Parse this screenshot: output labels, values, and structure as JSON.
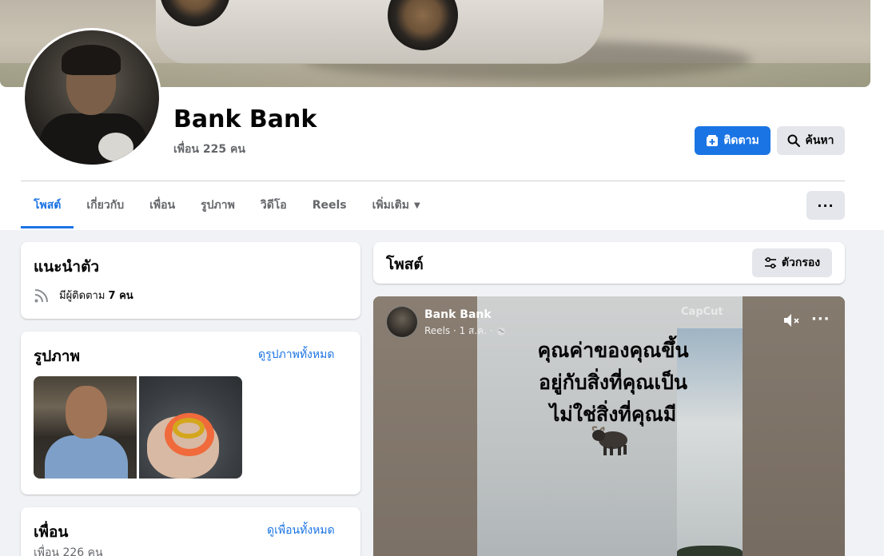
{
  "profile": {
    "name": "Bank Bank",
    "friends_count": "เพื่อน 225 คน"
  },
  "actions": {
    "follow_label": "ติดตาม",
    "search_label": "ค้นหา",
    "more_label": "···"
  },
  "tabs": [
    {
      "label": "โพสต์",
      "active": true
    },
    {
      "label": "เกี่ยวกับ"
    },
    {
      "label": "เพื่อน"
    },
    {
      "label": "รูปภาพ"
    },
    {
      "label": "วิดีโอ"
    },
    {
      "label": "Reels"
    },
    {
      "label": "เพิ่มเติม"
    }
  ],
  "intro": {
    "title": "แนะนำตัว",
    "followers_prefix": "มีผู้ติดตาม",
    "followers_value": "7 คน"
  },
  "photos": {
    "title": "รูปภาพ",
    "see_all": "ดูรูปภาพทั้งหมด"
  },
  "friends": {
    "title": "เพื่อน",
    "see_all": "ดูเพื่อนทั้งหมด",
    "count": "เพื่อน 226 คน"
  },
  "posts": {
    "title": "โพสต์",
    "filter_label": "ตัวกรอง"
  },
  "reel": {
    "author": "Bank Bank",
    "meta": "Reels · 1 ส.ค. ·",
    "watermark": "CapCut",
    "caption_lines": [
      "คุณค่าของคุณขึ้น",
      "อยู่กับสิ่งที่คุณเป็น",
      "ไม่ใช่สิ่งที่คุณมี"
    ]
  },
  "colors": {
    "accent": "#1b74e4",
    "background": "#f0f2f5",
    "secondary_text": "#65676b"
  }
}
